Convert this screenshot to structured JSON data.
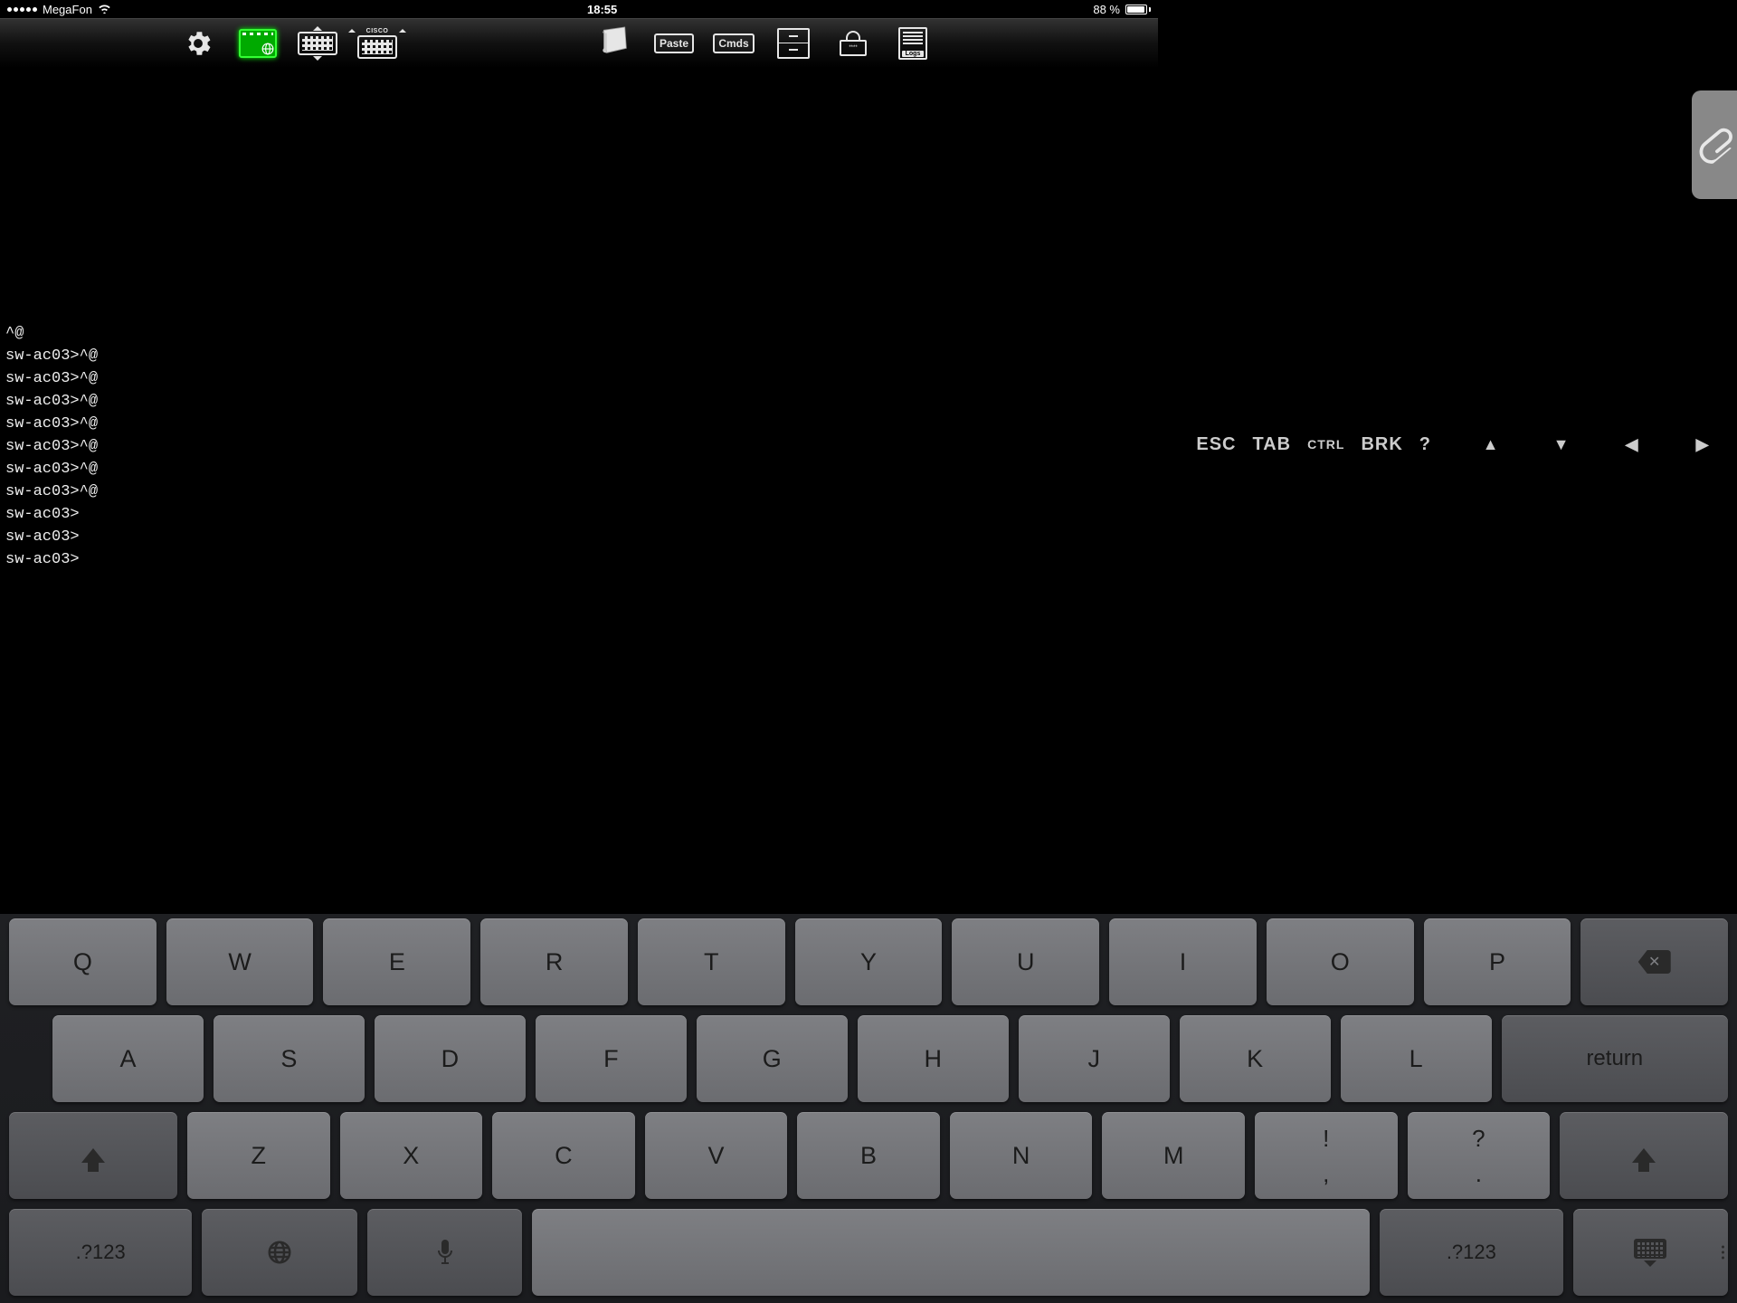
{
  "status": {
    "carrier": "MegaFon",
    "time": "18:55",
    "battery_text": "88 %",
    "battery_pct": 88
  },
  "toolbar": {
    "paste_label": "Paste",
    "cmds_label": "Cmds",
    "cisco_label": "CISCO",
    "logs_label": "Logs"
  },
  "terminal_lines": [
    "^@",
    "sw-ac03>^@",
    "sw-ac03>^@",
    "sw-ac03>^@",
    "sw-ac03>^@",
    "sw-ac03>^@",
    "sw-ac03>^@",
    "sw-ac03>^@",
    "sw-ac03>",
    "sw-ac03>",
    "sw-ac03>"
  ],
  "special_keys": {
    "esc": "ESC",
    "tab": "TAB",
    "ctrl": "CTRL",
    "brk": "BRK",
    "qmark": "?"
  },
  "keys": {
    "row1": [
      "Q",
      "W",
      "E",
      "R",
      "T",
      "Y",
      "U",
      "I",
      "O",
      "P"
    ],
    "row2": [
      "A",
      "S",
      "D",
      "F",
      "G",
      "H",
      "J",
      "K",
      "L"
    ],
    "return": "return",
    "row3": [
      "Z",
      "X",
      "C",
      "V",
      "B",
      "N",
      "M"
    ],
    "excl_top": "!",
    "excl_bot": ",",
    "q_top": "?",
    "q_bot": ".",
    "numsym": ".?123"
  }
}
